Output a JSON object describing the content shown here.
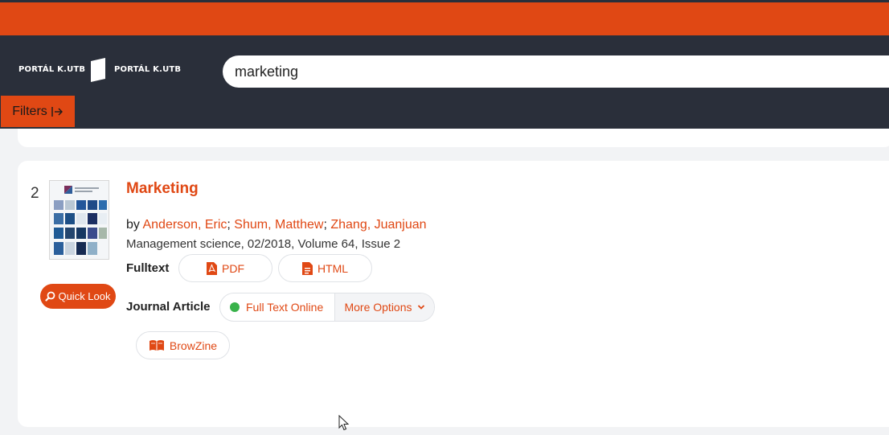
{
  "header": {
    "logo_left": "PORTÁL K.UTB",
    "logo_right": "PORTÁL K.UTB"
  },
  "search": {
    "value": "marketing"
  },
  "filters": {
    "label": "Filters",
    "icon": "arrow-right-to-bar-icon"
  },
  "result": {
    "number": "2",
    "cover": "Management Science journal cover",
    "quick_look_label": "Quick Look",
    "title": "Marketing",
    "by_label": "by",
    "authors": [
      "Anderson, Eric",
      "Shum, Matthew",
      "Zhang, Juanjuan"
    ],
    "source": "Management science, 02/2018, Volume 64, Issue 2",
    "fulltext_label": "Fulltext",
    "pdf_label": "PDF",
    "html_label": "HTML",
    "type_label": "Journal Article",
    "full_text_online_label": "Full Text Online",
    "more_options_label": "More Options",
    "browzine_label": "BrowZine"
  },
  "colors": {
    "accent": "#e04814",
    "header_bg": "#2a2f3a",
    "available": "#38b24a"
  }
}
